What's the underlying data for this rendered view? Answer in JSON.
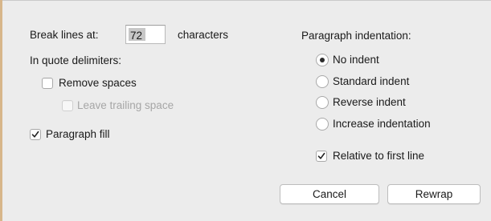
{
  "break_lines": {
    "label": "Break lines at:",
    "value": "72",
    "suffix": "characters"
  },
  "quote_delimiters": {
    "heading": "In quote delimiters:",
    "remove_spaces": {
      "label": "Remove spaces",
      "checked": false
    },
    "leave_trailing_space": {
      "label": "Leave trailing space",
      "checked": false,
      "enabled": false
    }
  },
  "paragraph_fill": {
    "label": "Paragraph fill",
    "checked": true
  },
  "paragraph_indentation": {
    "heading": "Paragraph indentation:",
    "options": [
      {
        "label": "No indent",
        "selected": true
      },
      {
        "label": "Standard indent",
        "selected": false
      },
      {
        "label": "Reverse indent",
        "selected": false
      },
      {
        "label": "Increase indentation",
        "selected": false
      }
    ],
    "relative_to_first_line": {
      "label": "Relative to first line",
      "checked": true
    }
  },
  "buttons": {
    "cancel": "Cancel",
    "rewrap": "Rewrap"
  },
  "colors": {
    "background": "#ececec",
    "sheet_edge": "#d7b68a",
    "disabled_text": "#a6a6a6"
  },
  "icons": {
    "check": "checkmark-icon",
    "radio": "radio-dot-icon"
  }
}
